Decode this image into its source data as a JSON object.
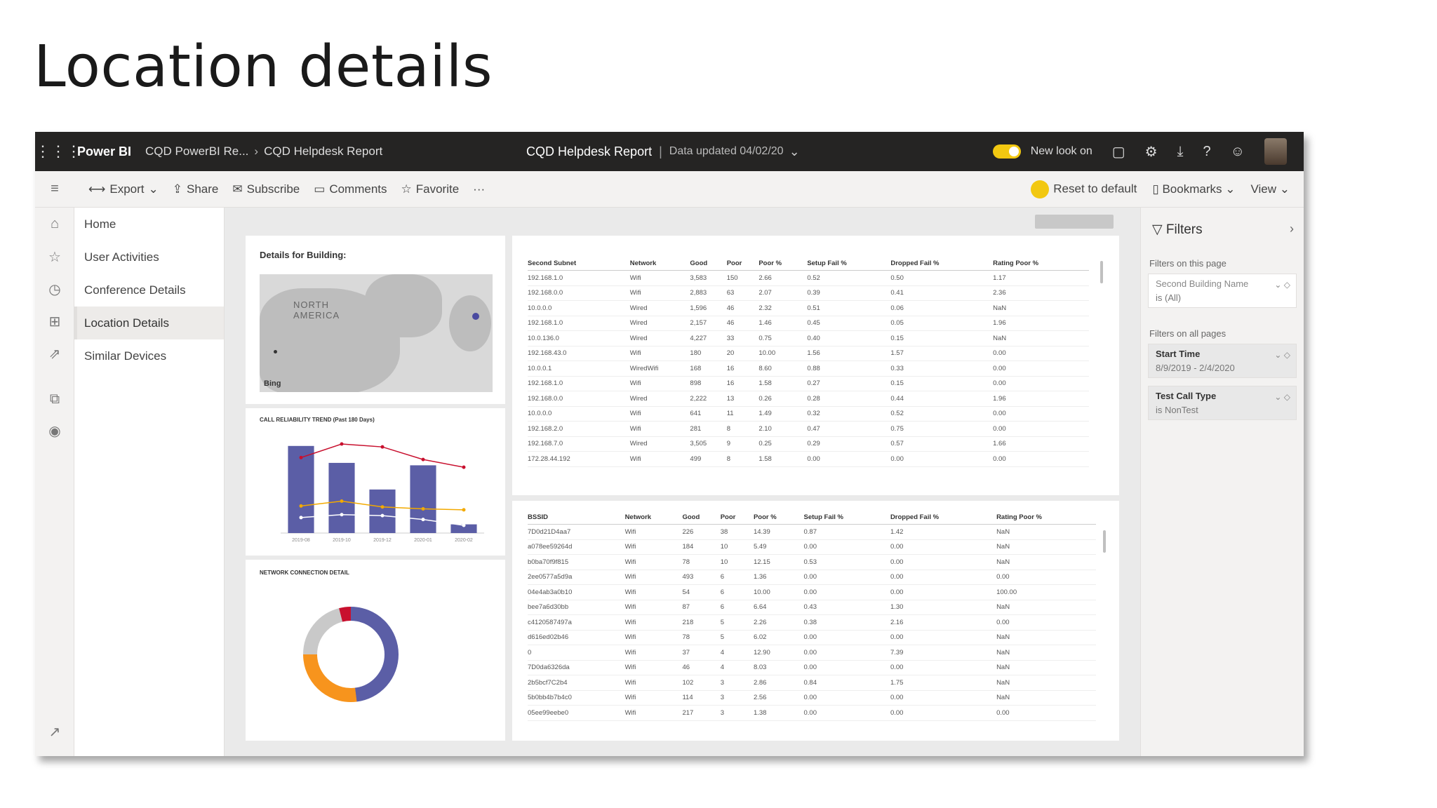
{
  "slide": {
    "title": "Location details"
  },
  "topbar": {
    "brand": "Power BI",
    "crumb1": "CQD PowerBI Re...",
    "crumb2": "CQD Helpdesk Report",
    "report_title": "CQD Helpdesk Report",
    "data_updated": "Data updated 04/02/20",
    "new_look": "New look on"
  },
  "actionbar": {
    "export": "Export",
    "share": "Share",
    "subscribe": "Subscribe",
    "comments": "Comments",
    "favorite": "Favorite",
    "more": "···",
    "reset": "Reset to default",
    "bookmarks": "Bookmarks",
    "view": "View"
  },
  "pages": [
    "Home",
    "User Activities",
    "Conference Details",
    "Location Details",
    "Similar Devices"
  ],
  "canvas": {
    "details_title": "Details for Building:",
    "map_label_1": "NORTH",
    "map_label_2": "AMERICA",
    "map_attribution": "Bing",
    "trend_title": "CALL RELIABILITY TREND (Past 180 Days)",
    "network_title": "NETWORK CONNECTION DETAIL"
  },
  "table1": {
    "headers": [
      "Second Subnet",
      "Network",
      "Good",
      "Poor",
      "Poor %",
      "Setup Fail %",
      "Dropped Fail %",
      "Rating Poor %"
    ],
    "rows": [
      [
        "192.168.1.0",
        "Wifi",
        "3,583",
        "150",
        "2.66",
        "0.52",
        "0.50",
        "1.17"
      ],
      [
        "192.168.0.0",
        "Wifi",
        "2,883",
        "63",
        "2.07",
        "0.39",
        "0.41",
        "2.36"
      ],
      [
        "10.0.0.0",
        "Wired",
        "1,596",
        "46",
        "2.32",
        "0.51",
        "0.06",
        "NaN"
      ],
      [
        "192.168.1.0",
        "Wired",
        "2,157",
        "46",
        "1.46",
        "0.45",
        "0.05",
        "1.96"
      ],
      [
        "10.0.136.0",
        "Wired",
        "4,227",
        "33",
        "0.75",
        "0.40",
        "0.15",
        "NaN"
      ],
      [
        "192.168.43.0",
        "Wifi",
        "180",
        "20",
        "10.00",
        "1.56",
        "1.57",
        "0.00"
      ],
      [
        "10.0.0.1",
        "WiredWifi",
        "168",
        "16",
        "8.60",
        "0.88",
        "0.33",
        "0.00"
      ],
      [
        "192.168.1.0",
        "Wifi",
        "898",
        "16",
        "1.58",
        "0.27",
        "0.15",
        "0.00"
      ],
      [
        "192.168.0.0",
        "Wired",
        "2,222",
        "13",
        "0.26",
        "0.28",
        "0.44",
        "1.96"
      ],
      [
        "10.0.0.0",
        "Wifi",
        "641",
        "11",
        "1.49",
        "0.32",
        "0.52",
        "0.00"
      ],
      [
        "192.168.2.0",
        "Wifi",
        "281",
        "8",
        "2.10",
        "0.47",
        "0.75",
        "0.00"
      ],
      [
        "192.168.7.0",
        "Wired",
        "3,505",
        "9",
        "0.25",
        "0.29",
        "0.57",
        "1.66"
      ],
      [
        "172.28.44.192",
        "Wifi",
        "499",
        "8",
        "1.58",
        "0.00",
        "0.00",
        "0.00"
      ]
    ]
  },
  "table2": {
    "headers": [
      "BSSID",
      "Network",
      "Good",
      "Poor",
      "Poor %",
      "Setup Fail %",
      "Dropped Fail %",
      "Rating Poor %"
    ],
    "rows": [
      [
        "7D0d21D4aa7",
        "Wifi",
        "226",
        "38",
        "14.39",
        "0.87",
        "1.42",
        "NaN"
      ],
      [
        "a078ee59264d",
        "Wifi",
        "184",
        "10",
        "5.49",
        "0.00",
        "0.00",
        "NaN"
      ],
      [
        "b0ba70f9f815",
        "Wifi",
        "78",
        "10",
        "12.15",
        "0.53",
        "0.00",
        "NaN"
      ],
      [
        "2ee0577a5d9a",
        "Wifi",
        "493",
        "6",
        "1.36",
        "0.00",
        "0.00",
        "0.00"
      ],
      [
        "04e4ab3a0b10",
        "Wifi",
        "54",
        "6",
        "10.00",
        "0.00",
        "0.00",
        "100.00"
      ],
      [
        "bee7a6d30bb",
        "Wifi",
        "87",
        "6",
        "6.64",
        "0.43",
        "1.30",
        "NaN"
      ],
      [
        "c4120587497a",
        "Wifi",
        "218",
        "5",
        "2.26",
        "0.38",
        "2.16",
        "0.00"
      ],
      [
        "d616ed02b46",
        "Wifi",
        "78",
        "5",
        "6.02",
        "0.00",
        "0.00",
        "NaN"
      ],
      [
        "0",
        "Wifi",
        "37",
        "4",
        "12.90",
        "0.00",
        "7.39",
        "NaN"
      ],
      [
        "7D0da6326da",
        "Wifi",
        "46",
        "4",
        "8.03",
        "0.00",
        "0.00",
        "NaN"
      ],
      [
        "2b5bcf7C2b4",
        "Wifi",
        "102",
        "3",
        "2.86",
        "0.84",
        "1.75",
        "NaN"
      ],
      [
        "5b0bb4b7b4c0",
        "Wifi",
        "114",
        "3",
        "2.56",
        "0.00",
        "0.00",
        "NaN"
      ],
      [
        "05ee99eebe0",
        "Wifi",
        "217",
        "3",
        "1.38",
        "0.00",
        "0.00",
        "0.00"
      ]
    ]
  },
  "filters": {
    "title": "Filters",
    "on_this_page": "Filters on this page",
    "filter1_name": "Second Building Name",
    "filter1_value": "is (All)",
    "on_all_pages": "Filters on all pages",
    "filter2_name": "Start Time",
    "filter2_value": "8/9/2019 - 2/4/2020",
    "filter3_name": "Test Call Type",
    "filter3_value": "is NonTest"
  },
  "colors": {
    "bar": "#5b5ea6",
    "line_red": "#c8102e",
    "line_yellow": "#f2a900",
    "donut_purple": "#5b5ea6",
    "donut_orange": "#f7941d",
    "donut_gray": "#c9c9c9",
    "donut_red": "#c8102e"
  },
  "chart_data": [
    {
      "type": "bar",
      "title": "CALL RELIABILITY TREND (Past 180 Days)",
      "categories": [
        "2019-08",
        "2019-10",
        "2019-12",
        "2020-01",
        "2020-02"
      ],
      "series": [
        {
          "values": [
            180,
            145,
            90,
            140,
            18
          ]
        },
        {
          "values": [
            7.8,
            9.2,
            8.9,
            7.6,
            6.8
          ]
        },
        {
          "values": [
            2.8,
            3.3,
            2.7,
            2.5,
            2.4
          ]
        },
        {
          "values": [
            1.6,
            1.9,
            1.8,
            1.4,
            0.8
          ]
        }
      ],
      "ylim": [
        0,
        200
      ]
    },
    {
      "type": "pie",
      "title": "NETWORK CONNECTION DETAIL",
      "slices": [
        {
          "value": 48
        },
        {
          "value": 27
        },
        {
          "value": 21
        },
        {
          "value": 4
        }
      ]
    }
  ]
}
